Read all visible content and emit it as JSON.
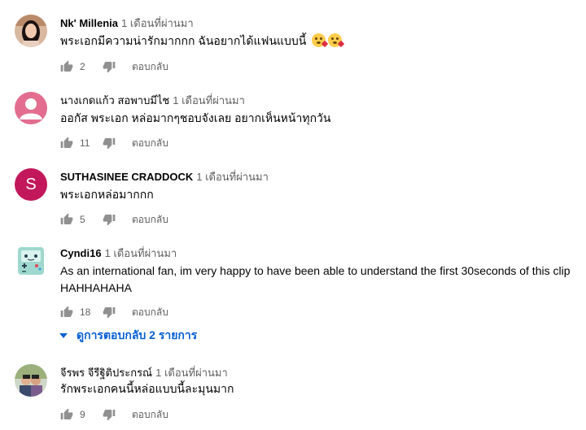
{
  "comments": [
    {
      "author": "Nk' Millenia",
      "time": "1 เดือนที่ผ่านมา",
      "text": "พระเอกมีความน่ารักมากกก ฉันอยากได้แฟนแบบนี้",
      "likes": "2",
      "reply_label": "ตอบกลับ",
      "avatar": "photo-avatar-woman"
    },
    {
      "author": "นางเกดแก้ว สอพาบมีไช",
      "time": "1 เดือนที่ผ่านมา",
      "text": "ออกัส พระเอก หล่อมากๆชอบจังเลย อยากเห็นหน้าทุกวัน",
      "likes": "11",
      "reply_label": "ตอบกลับ",
      "avatar": "default-person-avatar",
      "avatar_color": "#e26d8f"
    },
    {
      "author": "SUTHASINEE CRADDOCK",
      "time": "1 เดือนที่ผ่านมา",
      "text": "พระเอกหล่อมากกก",
      "likes": "5",
      "reply_label": "ตอบกลับ",
      "avatar": "letter-avatar",
      "avatar_letter": "S",
      "avatar_color": "#c2185b"
    },
    {
      "author": "Cyndi16",
      "time": "1 เดือนที่ผ่านมา",
      "text_line1": "As an international fan, im very happy to have been able to understand the first 30seconds of this clip",
      "text_line2": "HAHHAHAHA",
      "likes": "18",
      "reply_label": "ตอบกลับ",
      "avatar": "robot-avatar",
      "view_replies": "ดูการตอบกลับ 2 รายการ"
    },
    {
      "author": "จีรพร จีรีฐิติประกรณ์",
      "time": "1 เดือนที่ผ่านมา",
      "text": "รักพระเอกคนนี้หล่อแบบนี้ละมุนมาก",
      "likes": "9",
      "reply_label": "ตอบกลับ",
      "avatar": "photo-avatar-group"
    }
  ],
  "colors": {
    "link_blue": "#065fd4",
    "secondary_text": "#606060",
    "icon": "#909090"
  }
}
